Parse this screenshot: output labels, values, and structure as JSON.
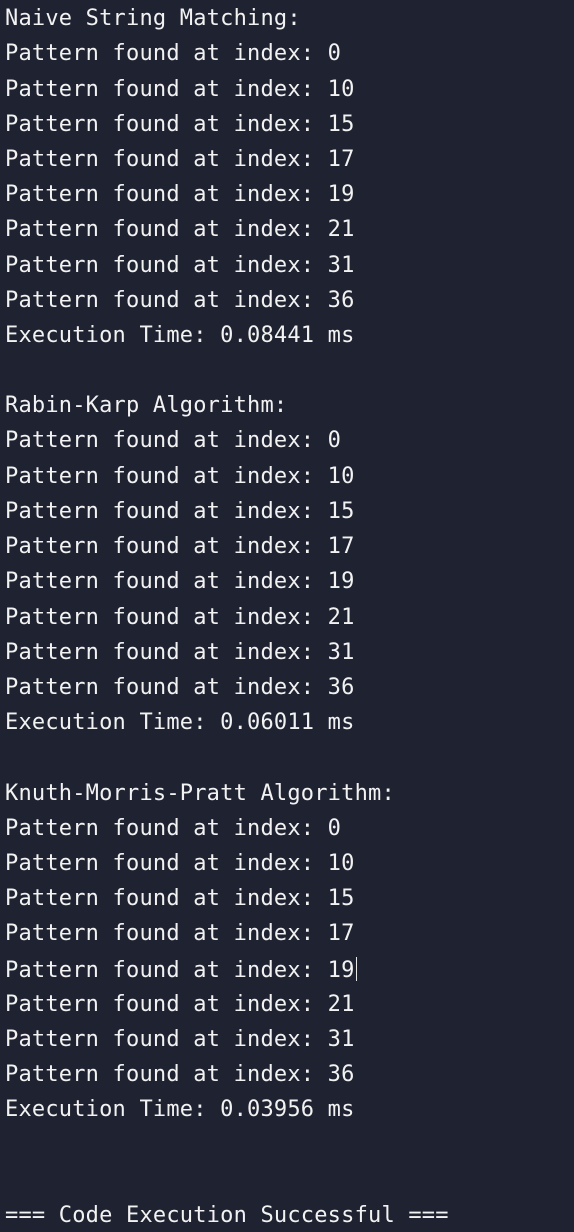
{
  "output": {
    "section1": {
      "title": "Naive String Matching:",
      "lines": [
        "Pattern found at index: 0",
        "Pattern found at index: 10",
        "Pattern found at index: 15",
        "Pattern found at index: 17",
        "Pattern found at index: 19",
        "Pattern found at index: 21",
        "Pattern found at index: 31",
        "Pattern found at index: 36"
      ],
      "time": "Execution Time: 0.08441 ms"
    },
    "section2": {
      "title": "Rabin-Karp Algorithm:",
      "lines": [
        "Pattern found at index: 0",
        "Pattern found at index: 10",
        "Pattern found at index: 15",
        "Pattern found at index: 17",
        "Pattern found at index: 19",
        "Pattern found at index: 21",
        "Pattern found at index: 31",
        "Pattern found at index: 36"
      ],
      "time": "Execution Time: 0.06011 ms"
    },
    "section3": {
      "title": "Knuth-Morris-Pratt Algorithm:",
      "lines": [
        "Pattern found at index: 0",
        "Pattern found at index: 10",
        "Pattern found at index: 15",
        "Pattern found at index: 17",
        "Pattern found at index: 19",
        "Pattern found at index: 21",
        "Pattern found at index: 31",
        "Pattern found at index: 36"
      ],
      "time": "Execution Time: 0.03956 ms"
    },
    "status": "=== Code Execution Successful ==="
  }
}
